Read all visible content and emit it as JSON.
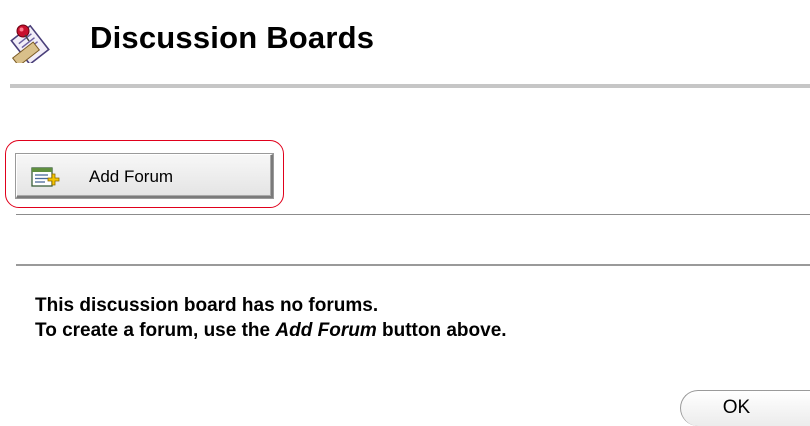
{
  "header": {
    "title": "Discussion Boards",
    "icon": "discussion-board-icon"
  },
  "toolbar": {
    "add_forum_label": "Add Forum",
    "add_forum_icon": "add-forum-icon",
    "highlight_color": "#e0001b"
  },
  "message": {
    "line1": "This discussion board has no forums.",
    "line2_before": "To create a forum, use the ",
    "line2_emphasis": "Add Forum",
    "line2_after": " button above."
  },
  "footer": {
    "ok_label": "OK"
  }
}
